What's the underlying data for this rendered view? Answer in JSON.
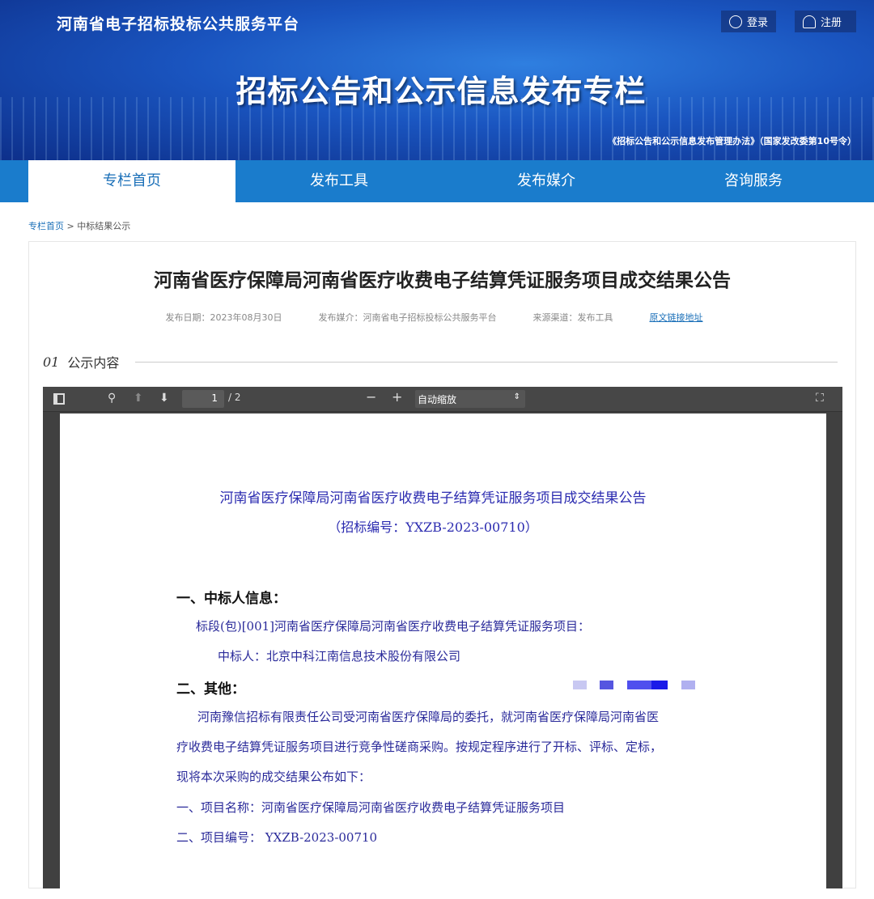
{
  "header": {
    "site_name": "河南省电子招标投标公共服务平台",
    "login": "登录",
    "register": "注册",
    "banner_title": "招标公告和公示信息发布专栏",
    "law_ref": "《招标公告和公示信息发布管理办法》（国家发改委第10号令）"
  },
  "nav": {
    "tabs": [
      "专栏首页",
      "发布工具",
      "发布媒介",
      "咨询服务"
    ]
  },
  "breadcrumb": {
    "home": "专栏首页",
    "sep": " > ",
    "current": "中标结果公示"
  },
  "article": {
    "title": "河南省医疗保障局河南省医疗收费电子结算凭证服务项目成交结果公告",
    "date": "发布日期：2023年08月30日",
    "media": "发布媒介：河南省电子招标投标公共服务平台",
    "source": "来源渠道：发布工具",
    "link": "原文链接地址"
  },
  "section": {
    "num": "01",
    "label": "公示内容"
  },
  "viewer": {
    "page": "1",
    "total": "/ 2",
    "zoom": "自动缩放",
    "zoom_arrow": "⇕"
  },
  "doc": {
    "title": "河南省医疗保障局河南省医疗收费电子结算凭证服务项目成交结果公告",
    "code": "（招标编号：YXZB-2023-00710）",
    "h1": "一、中标人信息：",
    "lot": "标段(包)[001]河南省医疗保障局河南省医疗收费电子结算凭证服务项目：",
    "winner": "中标人：北京中科江南信息技术股份有限公司",
    "h2": "二、其他：",
    "p1": "河南豫信招标有限责任公司受河南省医疗保障局的委托，就河南省医疗保障局河南省医",
    "p2": "疗收费电子结算凭证服务项目进行竞争性磋商采购。按规定程序进行了开标、评标、定标，",
    "p3": "现将本次采购的成交结果公布如下：",
    "i1": "一、项目名称：河南省医疗保障局河南省医疗收费电子结算凭证服务项目",
    "i2": "二、项目编号： YXZB-2023-00710"
  }
}
